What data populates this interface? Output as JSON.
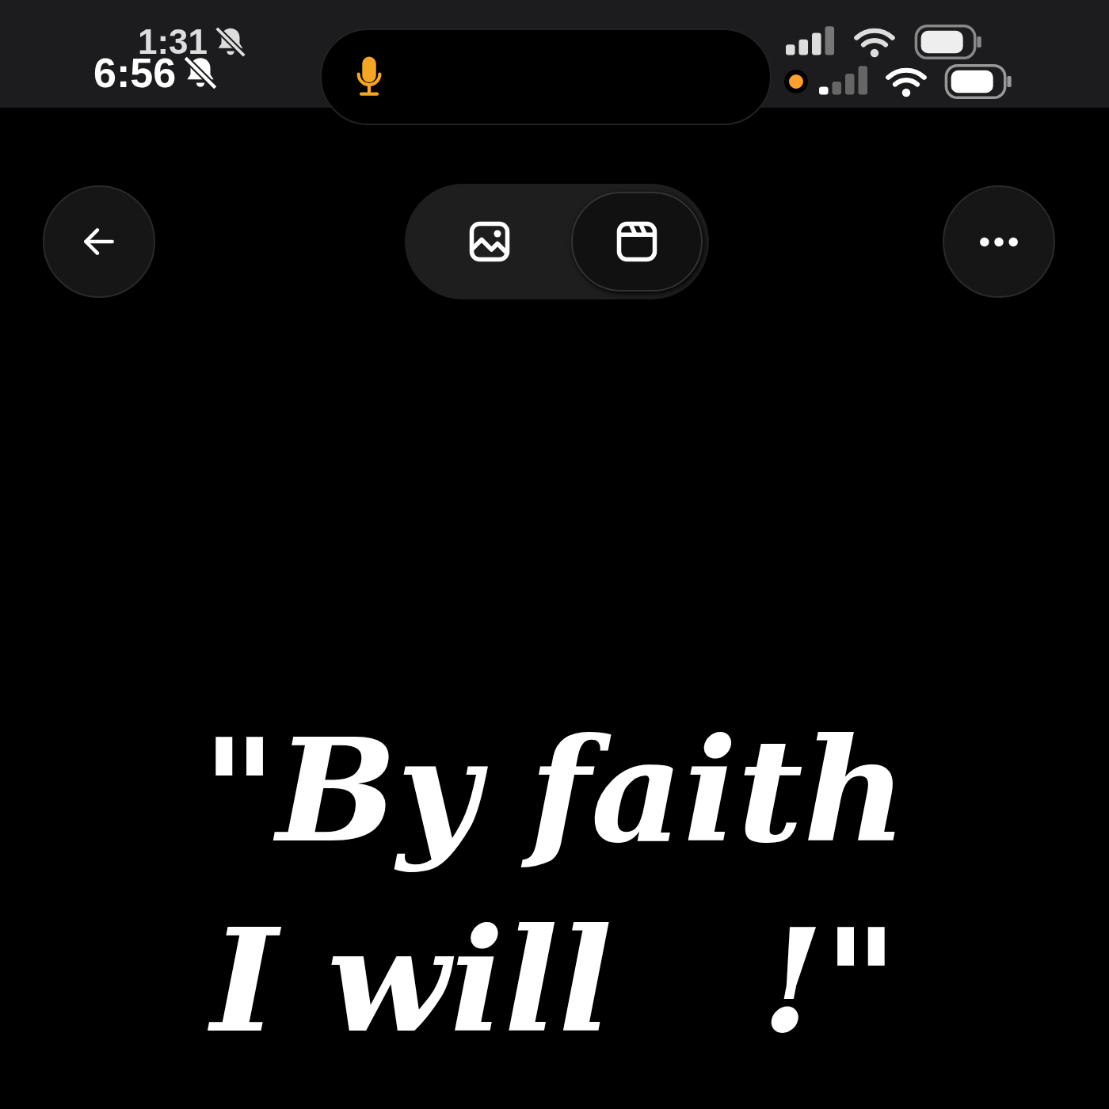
{
  "status_bars": [
    {
      "time": "1:31",
      "silent": true
    },
    {
      "time": "6:56",
      "silent": true
    }
  ],
  "segments": [
    {
      "kind": "photo",
      "selected": false
    },
    {
      "kind": "reel",
      "selected": true
    }
  ],
  "quote": {
    "lines": [
      "\"By faith",
      "I will   !\""
    ]
  }
}
